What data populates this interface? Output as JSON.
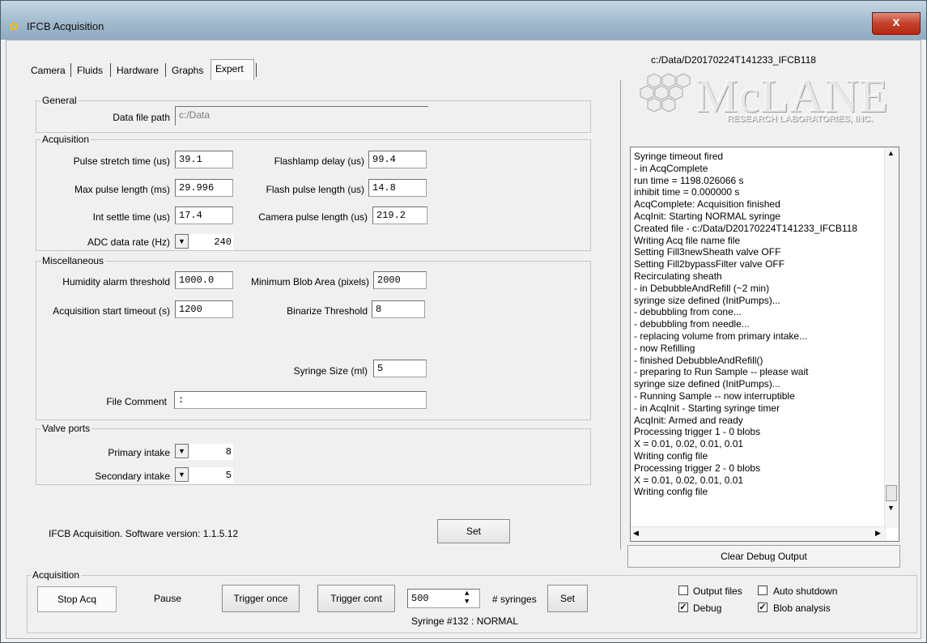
{
  "window": {
    "title": "IFCB Acquisition",
    "close_glyph": "x"
  },
  "tabs": [
    "Camera",
    "Fluids",
    "Hardware",
    "Graphs",
    "Expert"
  ],
  "general": {
    "group_label": "General",
    "data_file_path_label": "Data file path",
    "data_file_path_value": "c:/Data"
  },
  "acquisition": {
    "group_label": "Acquisition",
    "pulse_stretch_label": "Pulse stretch time (us)",
    "pulse_stretch_value": "39.1",
    "flashlamp_delay_label": "Flashlamp delay (us)",
    "flashlamp_delay_value": "99.4",
    "max_pulse_label": "Max pulse length (ms)",
    "max_pulse_value": "29.996",
    "flash_pulse_label": "Flash pulse length (us)",
    "flash_pulse_value": "14.8",
    "int_settle_label": "Int settle time (us)",
    "int_settle_value": "17.4",
    "camera_pulse_label": "Camera pulse length (us)",
    "camera_pulse_value": "219.2",
    "adc_rate_label": "ADC data rate (Hz)",
    "adc_rate_value": "240"
  },
  "misc": {
    "group_label": "Miscellaneous",
    "humidity_label": "Humidity alarm threshold",
    "humidity_value": "1000.0",
    "min_blob_label": "Minimum Blob Area (pixels)",
    "min_blob_value": "2000",
    "acq_timeout_label": "Acquisition start timeout (s)",
    "acq_timeout_value": "1200",
    "binarize_label": "Binarize Threshold",
    "binarize_value": "8",
    "syringe_size_label": "Syringe Size (ml)",
    "syringe_size_value": "5",
    "file_comment_label": "File Comment",
    "file_comment_value": ":"
  },
  "valve_ports": {
    "group_label": "Valve ports",
    "primary_label": "Primary intake",
    "primary_value": "8",
    "secondary_label": "Secondary intake",
    "secondary_value": "5"
  },
  "software_version": "IFCB Acquisition. Software version: 1.1.5.12",
  "set_label": "Set",
  "right_panel": {
    "file_path": "c:/Data/D20170224T141233_IFCB118",
    "logo_main": "McLANE",
    "logo_sub": "RESEARCH LABORATORIES, INC.",
    "debug_lines": [
      "Syringe timeout fired",
      " - in AcqComplete",
      "run time = 1198.026066 s",
      "inhibit time = 0.000000 s",
      "AcqComplete: Acquisition finished",
      "AcqInit: Starting NORMAL syringe",
      "Created file - c:/Data/D20170224T141233_IFCB118",
      "Writing Acq file name file",
      "Setting Fill3newSheath valve OFF",
      "Setting Fill2bypassFilter valve OFF",
      "Recirculating sheath",
      " - in DebubbleAndRefill (~2 min)",
      "syringe size defined (InitPumps)...",
      " - debubbling from cone...",
      " - debubbling from needle...",
      " - replacing volume from primary intake...",
      " - now Refilling",
      " - finished DebubbleAndRefill()",
      " - preparing to Run Sample -- please wait",
      "syringe size defined (InitPumps)...",
      " - Running Sample -- now interruptible",
      " - in AcqInit - Starting syringe timer",
      "AcqInit: Armed and ready",
      "Processing trigger 1 - 0 blobs",
      "X = 0.01, 0.02, 0.01, 0.01",
      "Writing config file",
      "Processing trigger 2 - 0 blobs",
      "X = 0.01, 0.02, 0.01, 0.01",
      "Writing config file"
    ],
    "clear_debug_label": "Clear Debug Output"
  },
  "bottom_acq": {
    "group_label": "Acquisition",
    "stop_label": "Stop Acq",
    "pause_label": "Pause",
    "trigger_once_label": "Trigger once",
    "trigger_cont_label": "Trigger cont",
    "syringe_count_value": "500",
    "syringes_label": "# syringes",
    "set_label": "Set",
    "syringe_status": "Syringe #132 : NORMAL"
  },
  "options": {
    "output_files": {
      "label": "Output files",
      "checked": false
    },
    "auto_shutdown": {
      "label": "Auto shutdown",
      "checked": false
    },
    "debug": {
      "label": "Debug",
      "checked": true
    },
    "blob_analysis": {
      "label": "Blob analysis",
      "checked": true
    }
  }
}
